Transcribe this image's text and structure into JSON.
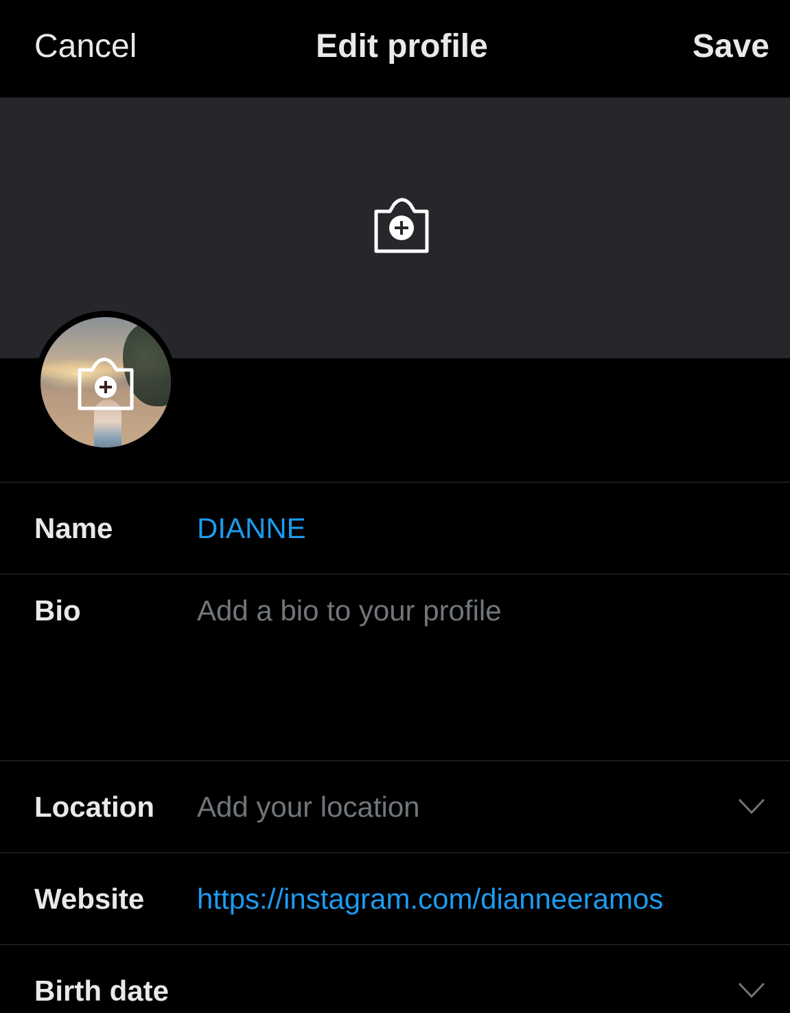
{
  "header": {
    "cancel_label": "Cancel",
    "title": "Edit profile",
    "save_label": "Save"
  },
  "icons": {
    "banner_camera": "camera-plus-icon",
    "avatar_camera": "camera-plus-icon",
    "location_chevron": "chevron-down-icon",
    "birthdate_chevron": "chevron-down-icon"
  },
  "fields": {
    "name": {
      "label": "Name",
      "value": "DIANNE"
    },
    "bio": {
      "label": "Bio",
      "placeholder": "Add a bio to your profile"
    },
    "location": {
      "label": "Location",
      "placeholder": "Add your location"
    },
    "website": {
      "label": "Website",
      "value": "https://instagram.com/dianneeramos"
    },
    "birthdate": {
      "label": "Birth date"
    }
  },
  "colors": {
    "background": "#000000",
    "banner": "#25272a",
    "accent": "#1d9bf0",
    "text": "#e7e9ea",
    "placeholder": "#71767b",
    "divider": "#2f3336"
  }
}
